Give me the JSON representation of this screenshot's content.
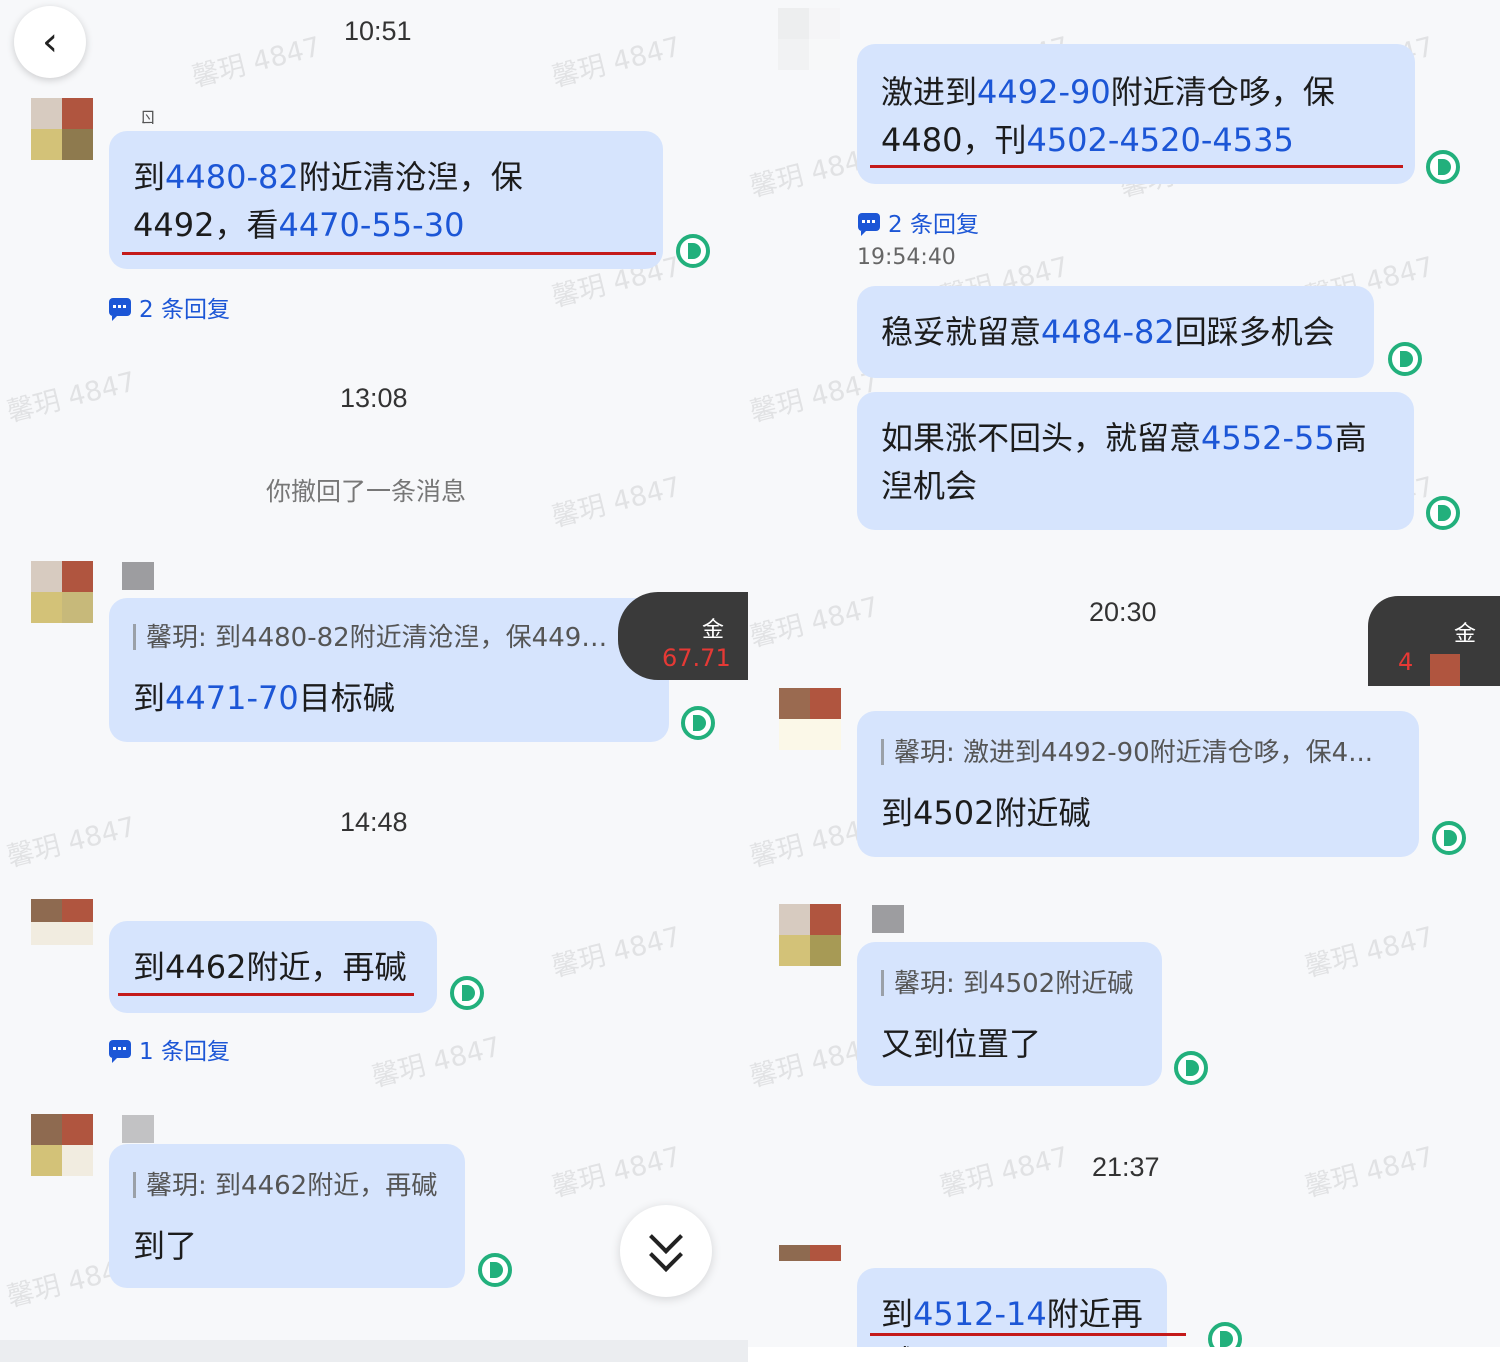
{
  "left": {
    "times": [
      "10:51",
      "13:08",
      "14:48"
    ],
    "recall_notice": "你撤回了一条消息",
    "msg1": {
      "a": "到",
      "b": "4480-82",
      "c": "附近清沧湼，保",
      "d": "4492，看",
      "e": "4470-55-30"
    },
    "msg1_replies": "2 条回复",
    "msg2": {
      "quote": "馨玥: 到4480-82附近清沧湼，保4492...",
      "a": "到",
      "b": "4471-70",
      "c": "目标碱"
    },
    "ticker": {
      "label": "金",
      "value": "67.71"
    },
    "msg3": {
      "text": "到4462附近，再碱"
    },
    "msg3_replies": "1 条回复",
    "msg4": {
      "quote": "馨玥: 到4462附近，再碱",
      "text": "到了"
    },
    "name_fragment": "ㄖ"
  },
  "right": {
    "msg1": {
      "a": "激进到",
      "b": "4492-90",
      "c": "附近清仓哆，保",
      "d": "4480，刊",
      "e": "4502-4520-4535"
    },
    "msg1_replies": "2 条回复",
    "timestamp": "19:54:40",
    "msg2": {
      "a": "稳妥就留意",
      "b": "4484-82",
      "c": "回踩多机会"
    },
    "msg3": {
      "a": "如果涨不回头，就留意",
      "b": "4552-55",
      "c": "高",
      "d": "湼机会"
    },
    "times": [
      "20:30",
      "21:37"
    ],
    "ticker": {
      "label": "金",
      "value": "4"
    },
    "msg4": {
      "quote": "馨玥: 激进到4492-90附近清仓哆，保4...",
      "text": "到4502附近碱"
    },
    "msg5": {
      "quote": "馨玥: 到4502附近碱",
      "text": "又到位置了"
    },
    "msg6": {
      "a": "到",
      "b": "4512-14",
      "c": "附近再碱"
    }
  },
  "watermark": "馨玥 4847",
  "colors": {
    "bubble": "#d6e4fd",
    "highlight": "#1c56d6",
    "underline": "#c41a1a",
    "status": "#22b07c"
  }
}
